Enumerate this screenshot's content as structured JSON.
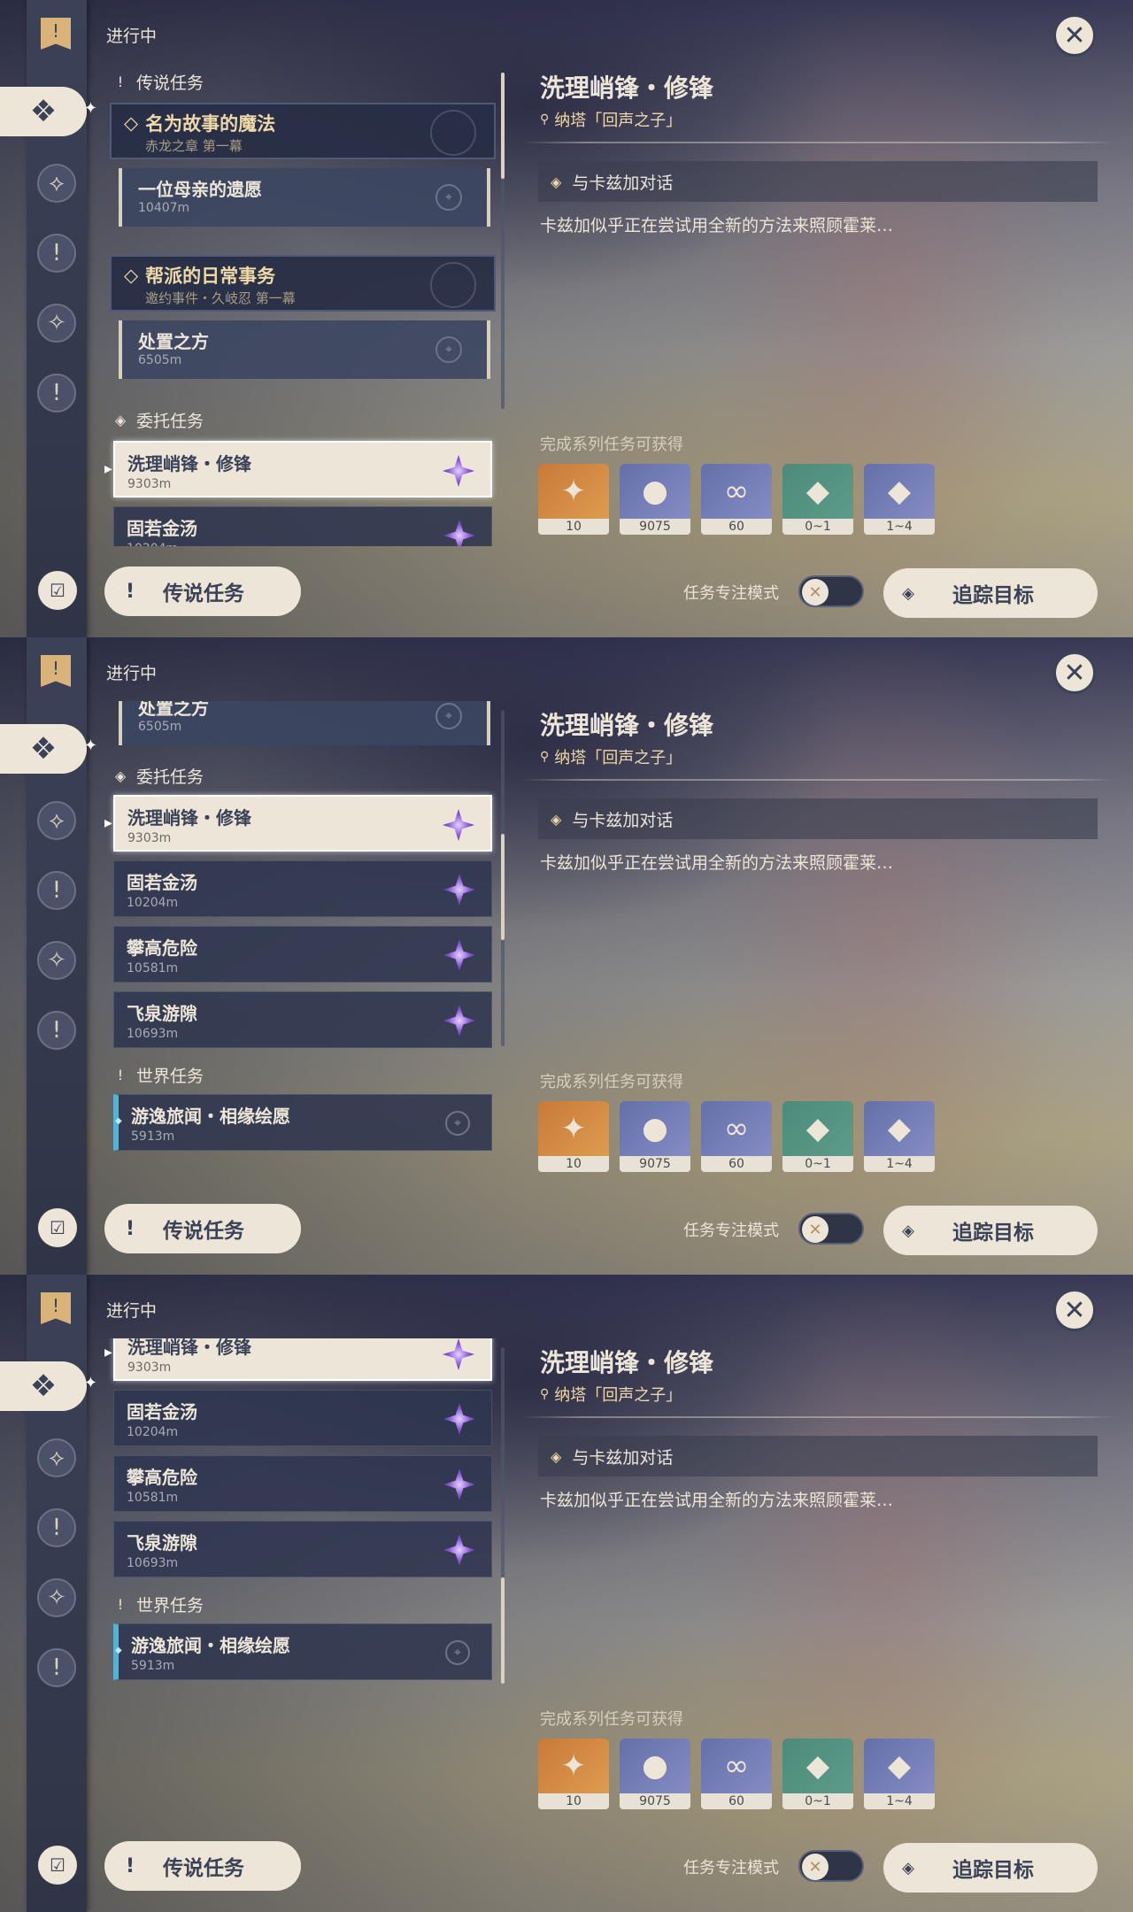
{
  "status_label": "进行中",
  "categories": {
    "legend": "传说任务",
    "commission": "委托任务",
    "world": "世界任务"
  },
  "legend_quests": [
    {
      "title": "名为故事的魔法",
      "chapter": "赤龙之章 第一幕",
      "sub_title": "一位母亲的遗愿",
      "sub_dist": "10407m"
    },
    {
      "title": "帮派的日常事务",
      "chapter": "邀约事件・久岐忍 第一幕",
      "sub_title": "处置之方",
      "sub_dist": "6505m"
    }
  ],
  "commissions": [
    {
      "title": "洗理峭锋・修锋",
      "dist": "9303m"
    },
    {
      "title": "固若金汤",
      "dist": "10204m"
    },
    {
      "title": "攀高危险",
      "dist": "10581m"
    },
    {
      "title": "飞泉游隙",
      "dist": "10693m"
    }
  ],
  "world_quests": [
    {
      "title": "游逸旅闻・相缘绘愿",
      "dist": "5913m"
    }
  ],
  "detail": {
    "title": "洗理峭锋・修锋",
    "location": "纳塔「回声之子」",
    "objective": "与卡兹加对话",
    "description": "卡兹加似乎正在尝试用全新的方法来照顾霍莱…",
    "reward_label": "完成系列任务可获得",
    "rewards": [
      {
        "icon": "primogem-icon",
        "count": "10"
      },
      {
        "icon": "mora-icon",
        "count": "9075"
      },
      {
        "icon": "adventure-exp-icon",
        "count": "60"
      },
      {
        "icon": "crystal-small-icon",
        "count": "0~1"
      },
      {
        "icon": "crystal-large-icon",
        "count": "1~4"
      }
    ]
  },
  "bottom": {
    "category_button": "传说任务",
    "focus_mode_label": "任务专注模式",
    "focus_mode_on": false,
    "track_button": "追踪目标"
  },
  "colors": {
    "accent": "#ece5d8",
    "rail": "#3b4258",
    "gold_text": "#efd9a8",
    "world_quest": "#4fb4d8",
    "commission_gem": "#8a5ad8"
  }
}
